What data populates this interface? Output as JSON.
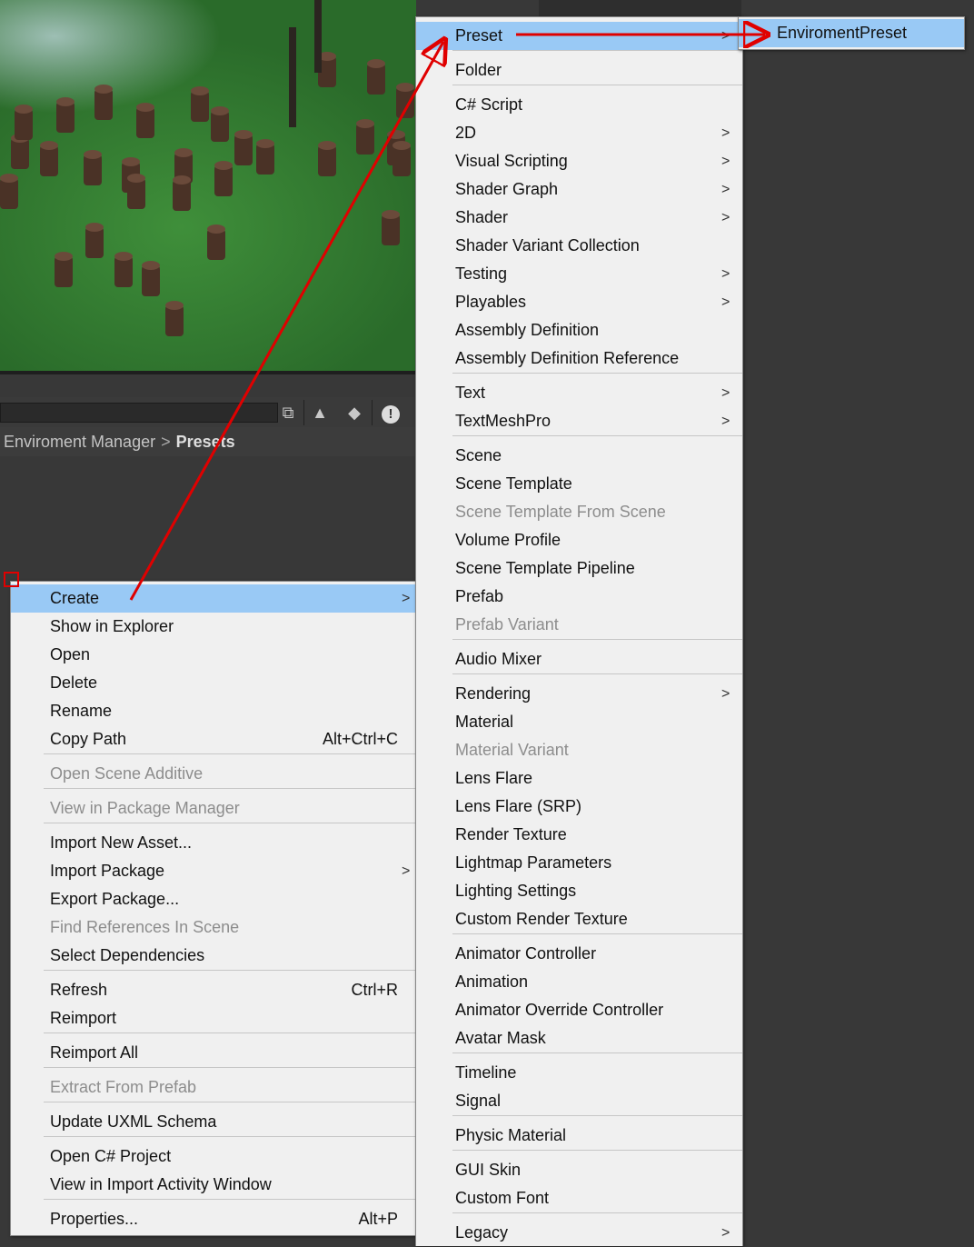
{
  "project_window": {
    "breadcrumb": {
      "parent": "Enviroment Manager",
      "separator": ">",
      "current": "Presets"
    },
    "toolbar_icons": [
      "resize-icon",
      "filter-by-type-icon",
      "filter-by-label-icon",
      "warning-icon"
    ]
  },
  "context_menu": {
    "items": [
      {
        "label": "Create",
        "arrow": ">",
        "highlighted": true
      },
      {
        "label": "Show in Explorer"
      },
      {
        "label": "Open"
      },
      {
        "label": "Delete"
      },
      {
        "label": "Rename"
      },
      {
        "label": "Copy Path",
        "shortcut": "Alt+Ctrl+C"
      },
      {
        "label": "Open Scene Additive",
        "disabled": true
      },
      {
        "label": "View in Package Manager",
        "disabled": true
      },
      {
        "label": "Import New Asset..."
      },
      {
        "label": "Import Package",
        "arrow": ">"
      },
      {
        "label": "Export Package..."
      },
      {
        "label": "Find References In Scene",
        "disabled": true
      },
      {
        "label": "Select Dependencies"
      },
      {
        "label": "Refresh",
        "shortcut": "Ctrl+R"
      },
      {
        "label": "Reimport"
      },
      {
        "label": "Reimport All"
      },
      {
        "label": "Extract From Prefab",
        "disabled": true
      },
      {
        "label": "Update UXML Schema"
      },
      {
        "label": "Open C# Project"
      },
      {
        "label": "View in Import Activity Window"
      },
      {
        "label": "Properties...",
        "shortcut": "Alt+P"
      }
    ]
  },
  "create_submenu": {
    "items": [
      {
        "label": "Preset",
        "arrow": ">",
        "highlighted": true
      },
      {
        "label": "Folder"
      },
      {
        "label": "C# Script"
      },
      {
        "label": "2D",
        "arrow": ">"
      },
      {
        "label": "Visual Scripting",
        "arrow": ">"
      },
      {
        "label": "Shader Graph",
        "arrow": ">"
      },
      {
        "label": "Shader",
        "arrow": ">"
      },
      {
        "label": "Shader Variant Collection"
      },
      {
        "label": "Testing",
        "arrow": ">"
      },
      {
        "label": "Playables",
        "arrow": ">"
      },
      {
        "label": "Assembly Definition"
      },
      {
        "label": "Assembly Definition Reference"
      },
      {
        "label": "Text",
        "arrow": ">"
      },
      {
        "label": "TextMeshPro",
        "arrow": ">"
      },
      {
        "label": "Scene"
      },
      {
        "label": "Scene Template"
      },
      {
        "label": "Scene Template From Scene",
        "disabled": true
      },
      {
        "label": "Volume Profile"
      },
      {
        "label": "Scene Template Pipeline"
      },
      {
        "label": "Prefab"
      },
      {
        "label": "Prefab Variant",
        "disabled": true
      },
      {
        "label": "Audio Mixer"
      },
      {
        "label": "Rendering",
        "arrow": ">"
      },
      {
        "label": "Material"
      },
      {
        "label": "Material Variant",
        "disabled": true
      },
      {
        "label": "Lens Flare"
      },
      {
        "label": "Lens Flare (SRP)"
      },
      {
        "label": "Render Texture"
      },
      {
        "label": "Lightmap Parameters"
      },
      {
        "label": "Lighting Settings"
      },
      {
        "label": "Custom Render Texture"
      },
      {
        "label": "Animator Controller"
      },
      {
        "label": "Animation"
      },
      {
        "label": "Animator Override Controller"
      },
      {
        "label": "Avatar Mask"
      },
      {
        "label": "Timeline"
      },
      {
        "label": "Signal"
      },
      {
        "label": "Physic Material"
      },
      {
        "label": "GUI Skin"
      },
      {
        "label": "Custom Font"
      },
      {
        "label": "Legacy",
        "arrow": ">"
      }
    ]
  },
  "preset_submenu": {
    "items": [
      {
        "label": "EnviromentPreset",
        "highlighted": true
      }
    ]
  },
  "colors": {
    "highlight": "#99c9f5",
    "annotation": "#e00000",
    "menu_bg": "#f0f0f0",
    "editor_bg": "#383838"
  }
}
